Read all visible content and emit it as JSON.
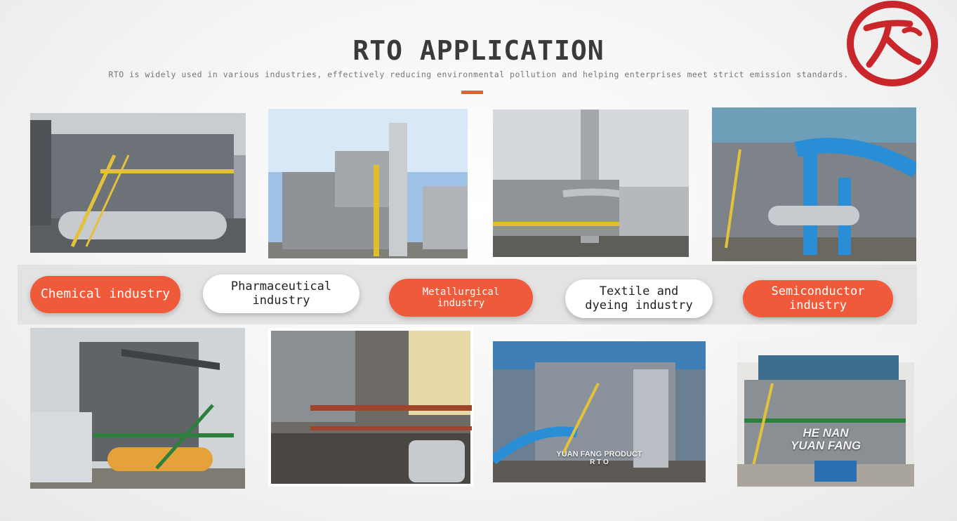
{
  "header": {
    "title": "RTO APPLICATION",
    "subtitle": "RTO is widely used in various industries, effectively reducing environmental pollution and helping enterprises meet strict emission standards."
  },
  "colors": {
    "accent": "#ee5a3a",
    "seal": "#c8262b",
    "band": "#e3e3e3"
  },
  "industries": [
    {
      "label": "Chemical industry",
      "active": true
    },
    {
      "label": "Pharmaceutical industry",
      "active": false
    },
    {
      "label": "Metallurgical industry",
      "active": true
    },
    {
      "label": "Textile and dyeing industry",
      "active": false
    },
    {
      "label": "Semiconductor industry",
      "active": true
    }
  ],
  "photos": [
    {
      "name": "rto-plant-photo-1"
    },
    {
      "name": "rto-plant-photo-2"
    },
    {
      "name": "rto-plant-photo-3"
    },
    {
      "name": "rto-plant-photo-4"
    },
    {
      "name": "rto-plant-photo-5"
    },
    {
      "name": "rto-plant-photo-6"
    },
    {
      "name": "rto-plant-photo-7",
      "caption_line1": "YUAN FANG PRODUCT",
      "caption_line2": "R T O"
    },
    {
      "name": "rto-plant-photo-8",
      "caption_line1": "HE NAN",
      "caption_line2": "YUAN FANG"
    }
  ]
}
